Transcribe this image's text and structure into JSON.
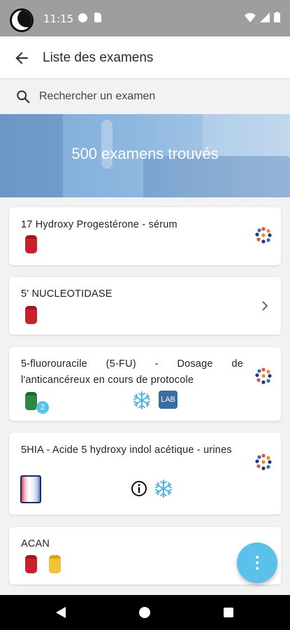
{
  "status_bar": {
    "time": "11:15"
  },
  "app_bar": {
    "title": "Liste des examens"
  },
  "search": {
    "placeholder": "Rechercher un examen"
  },
  "banner": {
    "text": "500 examens trouvés"
  },
  "exams": [
    {
      "title": "17 Hydroxy Progestérone - sérum",
      "tubes": [
        "red"
      ],
      "action": "lab-logo-icon"
    },
    {
      "title": "5' NUCLEOTIDASE",
      "tubes": [
        "red"
      ],
      "action": "chevron-right-icon"
    },
    {
      "title": "5-fluorouracile (5-FU) - Dosage de l'anticancéreux en cours de protocole",
      "tubes": [
        "green"
      ],
      "tube_count": "2",
      "badges": [
        "snowflake-icon",
        "lab-badge"
      ],
      "lab_badge_label": "LAB",
      "action": "lab-logo-icon"
    },
    {
      "title": "5HIA - Acide 5 hydroxy indol acétique - urines",
      "containers": [
        "urine-cup"
      ],
      "badges": [
        "info-icon",
        "snowflake-icon"
      ],
      "action": "lab-logo-icon"
    },
    {
      "title": "ACAN",
      "tubes": [
        "red",
        "yellow"
      ]
    }
  ],
  "colors": {
    "accent": "#5bc0ea",
    "tube_red": "#c9202d",
    "tube_green": "#2b8a3e",
    "tube_yellow": "#f2c23a",
    "lab_badge": "#3a6ea3",
    "status_bar": "#9e9e9e"
  },
  "fab": {
    "icon": "more-vertical-icon"
  }
}
